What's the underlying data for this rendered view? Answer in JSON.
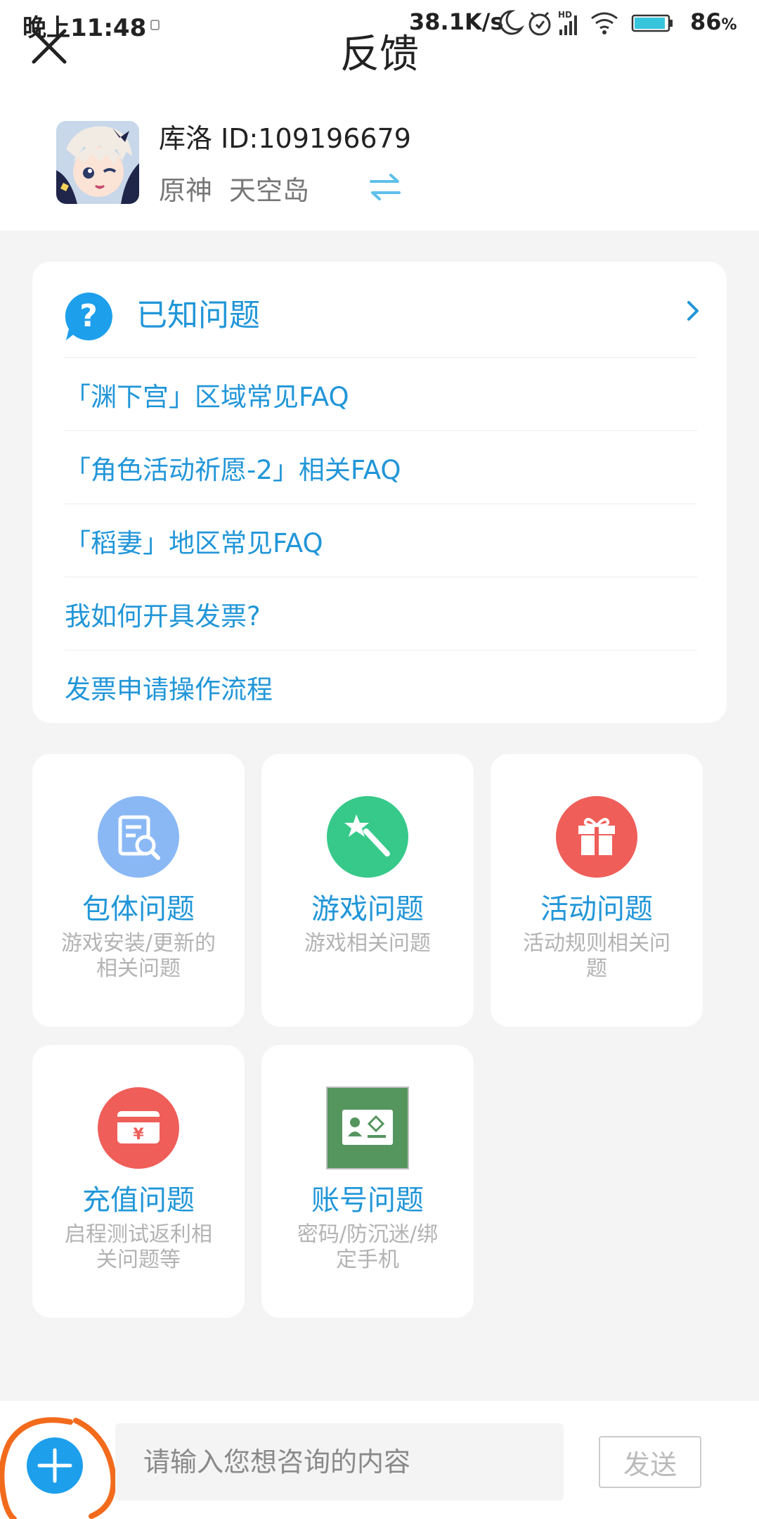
{
  "status_bar": {
    "time": "晚上11:48",
    "network_speed": "38.1K/s",
    "hd_label": "HD",
    "battery_value": "86",
    "battery_unit": "%",
    "icons": [
      "moon-icon",
      "alarm-icon",
      "signal-icon",
      "wifi-icon",
      "battery-icon"
    ]
  },
  "header": {
    "title": "反馈",
    "close_icon": "close-icon"
  },
  "account": {
    "user": "库洛 ID:109196679",
    "game": "原神",
    "server": "天空岛",
    "switch_icon": "swap-arrows-icon"
  },
  "faq": {
    "title": "已知问题",
    "items": [
      "「渊下宫」区域常见FAQ",
      "「角色活动祈愿-2」相关FAQ",
      "「稻妻」地区常见FAQ",
      "我如何开具发票?",
      "发票申请操作流程"
    ]
  },
  "categories": [
    {
      "title": "包体问题",
      "desc": "游戏安装/更新的相关问题",
      "icon": "package-search-icon",
      "color": "#8ab8f5"
    },
    {
      "title": "游戏问题",
      "desc": "游戏相关问题",
      "icon": "magic-wand-icon",
      "color": "#37c98a"
    },
    {
      "title": "活动问题",
      "desc": "活动规则相关问题",
      "icon": "gift-icon",
      "color": "#ef5e59"
    },
    {
      "title": "充值问题",
      "desc": "启程测试返利相关问题等",
      "icon": "yen-card-icon",
      "color": "#ef5e59"
    },
    {
      "title": "账号问题",
      "desc": "密码/防沉迷/绑定手机",
      "icon": "id-card-icon",
      "color": "#55955e"
    }
  ],
  "composer": {
    "placeholder": "请输入您想咨询的内容",
    "send_label": "发送"
  },
  "colors": {
    "accent": "#2196d8",
    "add_button": "#1d9fec",
    "annotation": "#f26b1d"
  }
}
